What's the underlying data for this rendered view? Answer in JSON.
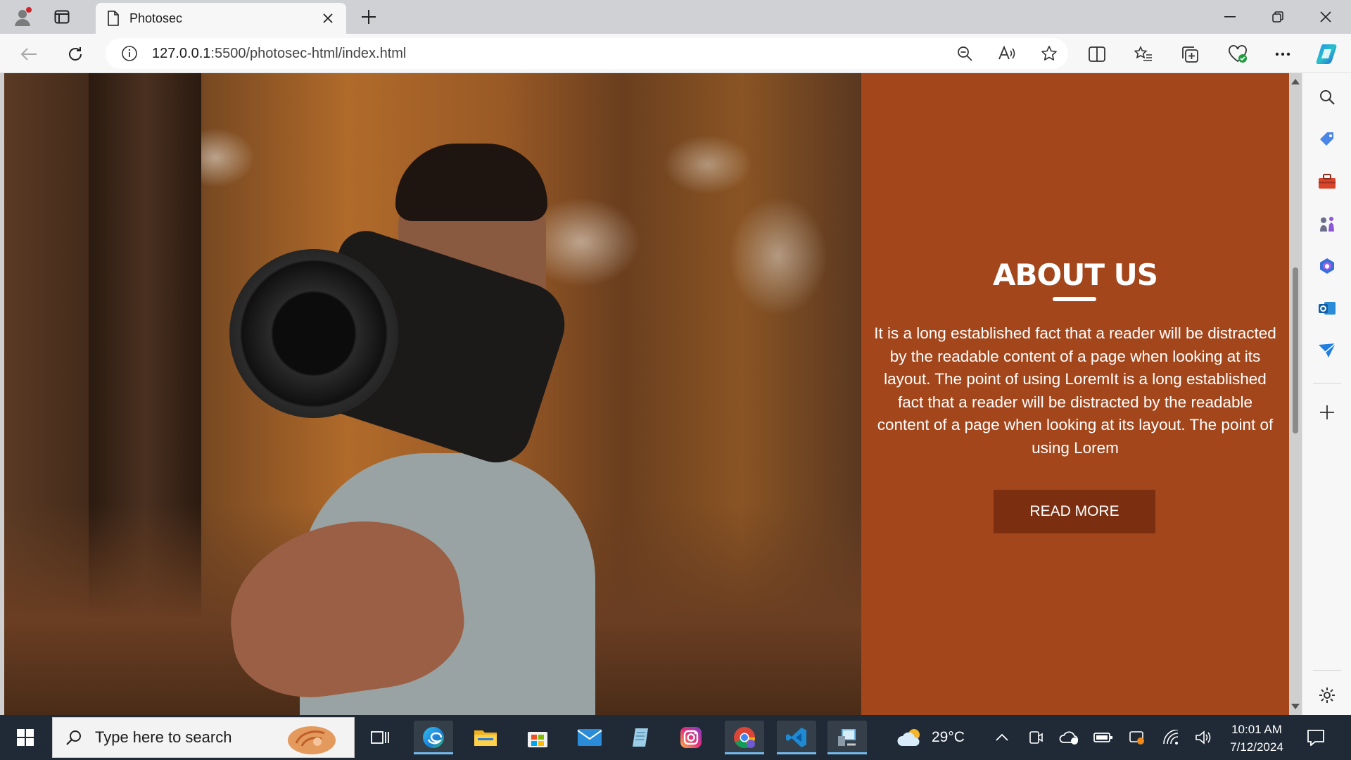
{
  "browser": {
    "tab_title": "Photosec",
    "url_host": "127.0.0.1",
    "url_path": ":5500/photosec-html/index.html"
  },
  "page": {
    "heading": "ABOUT US",
    "paragraph": "It is a long established fact that a reader will be distracted by the readable content of a page when looking at its layout. The point of using LoremIt is a long established fact that a reader will be distracted by the readable content of a page when looking at its layout. The point of using Lorem",
    "button_label": "READ MORE",
    "accent_color": "#a3461b",
    "button_color": "#7c2f10"
  },
  "taskbar": {
    "search_placeholder": "Type here to search",
    "weather_temp": "29°C",
    "time": "10:01 AM",
    "date": "7/12/2024"
  }
}
